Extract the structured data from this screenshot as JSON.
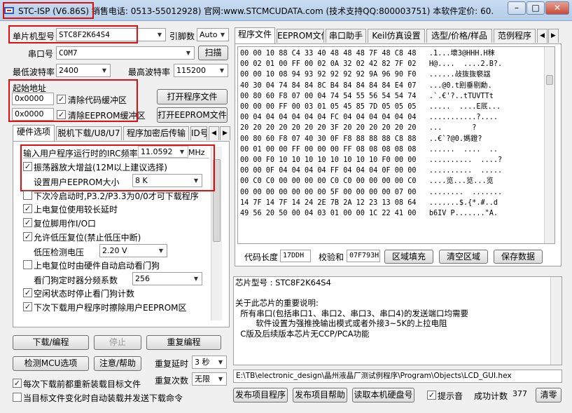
{
  "window": {
    "title": "STC-ISP (V6.86S) 销售电话: 0513-55012928) 官网:www.STCMCUDATA.com (技术支持QQ:800003751) 本软件定价: 60...",
    "minimize": "–",
    "maximize": "□",
    "close": "✕"
  },
  "left": {
    "chip_label": "单片机型号",
    "chip_value": "STC8F2K64S4",
    "pins_label": "引脚数",
    "pins_value": "Auto",
    "port_label": "串口号",
    "port_value": "COM7",
    "scan_button": "扫描",
    "min_baud_label": "最低波特率",
    "min_baud_value": "2400",
    "max_baud_label": "最高波特率",
    "max_baud_value": "115200",
    "start_addr_label": "起始地址",
    "code_addr": "0x0000",
    "clear_code_label": "清除代码缓冲区",
    "eeprom_addr": "0x0000",
    "clear_eeprom_label": "清除EEPROM缓冲区",
    "open_program_button": "打开程序文件",
    "open_eeprom_button": "打开EEPROM文件",
    "tabs": [
      "硬件选项",
      "脱机下载/U8/U7",
      "程序加密后传输",
      "ID号"
    ],
    "irc_label": "输入用户程序运行时的IRC频率",
    "irc_value": "11.0592",
    "irc_unit": "MHz",
    "options": [
      {
        "label": "振荡器放大增益(12M以上建议选择)",
        "checked": true
      },
      {
        "label": "设置用户EEPROM大小",
        "value": "8 K"
      },
      {
        "label": "下次冷启动时,P3.2/P3.3为0/0才可下载程序",
        "checked": false
      },
      {
        "label": "上电复位使用较长延时",
        "checked": true
      },
      {
        "label": "复位脚用作I/O口",
        "checked": true
      },
      {
        "label": "允许低压复位(禁止低压中断)",
        "checked": true
      },
      {
        "label": "低压检测电压",
        "value": "2.20 V"
      },
      {
        "label": "上电复位时由硬件自动启动看门狗",
        "checked": false
      },
      {
        "label": "看门狗定时器分频系数",
        "value": "256"
      },
      {
        "label": "空闲状态时停止看门狗计数",
        "checked": true
      },
      {
        "label": "下次下载用户程序时擦除用户EEPROM区",
        "checked": true
      }
    ],
    "download_button": "下载/编程",
    "stop_button": "停止",
    "reprogram_button": "重复编程",
    "detect_button": "检测MCU选项",
    "help_button": "注意/帮助",
    "repeat_delay_label": "重复延时",
    "repeat_delay_value": "3 秒",
    "repeat_count_label": "重复次数",
    "repeat_count_value": "无限",
    "reload_label": "每次下载前都重新装载目标文件",
    "auto_load_label": "当目标文件变化时自动装载并发送下载命令"
  },
  "right": {
    "tabs": [
      "程序文件",
      "EEPROM文件",
      "串口助手",
      "Keil仿真设置",
      "选型/价格/样品",
      "范例程序"
    ],
    "hex_rows": [
      {
        "hex": "00 00 10 88 C4 33 40 48 48 48 7F 48 C8 48",
        "ascii": ".1...壞3@HHH.H秣"
      },
      {
        "hex": "00 02 01 00 FF 00 02 0A 32 02 42 82 7F 02",
        "ascii": "H@....  ....2.B?."
      },
      {
        "hex": "00 00 10 08 94 93 92 92 92 92 9A 96 90 F0",
        "ascii": "......敁抜抜褻諡"
      },
      {
        "hex": "40 30 04 74 84 84 8C B4 84 84 84 84 E4 07",
        "ascii": "...@0.t刡垂剔勳."
      },
      {
        "hex": "00 80 60 F8 07 00 04 74 54 55 56 54 54 74",
        "ascii": ".`.€'?..tTUVTTt"
      },
      {
        "hex": "00 00 00 FF 00 03 01 05 45 85 7D 05 05 05",
        "ascii": ".....  ....E厎..."
      },
      {
        "hex": "00 04 04 04 04 04 04 FC 04 04 04 04 04 04",
        "ascii": "...........?...."
      },
      {
        "hex": "20 20 20 20 20 20 20 3F 20 20 20 20 20 20",
        "ascii": "...       ?"
      },
      {
        "hex": "00 80 60 F8 07 40 30 0F F8 88 88 88 C8 88",
        "ascii": "..€`?@0.媽鐙?"
      },
      {
        "hex": "00 01 00 00 FF 00 00 00 FF 08 08 08 08 08",
        "ascii": "......  ....  .."
      },
      {
        "hex": "00 00 F0 10 10 10 10 10 10 10 10 F0 00 00",
        "ascii": "..........  ....?"
      },
      {
        "hex": "00 00 0F 04 04 04 04 FF 04 04 04 0F 00 00",
        "ascii": "..........  ....."
      },
      {
        "hex": "00 C0 C0 00 00 00 00 C0 C0 00 00 00 00 C0",
        "ascii": "....览...览...览"
      },
      {
        "hex": "00 00 00 00 00 00 00 5F 00 00 00 00 07 00",
        "ascii": "........  ......."
      },
      {
        "hex": "14 7F 14 7F 14 24 2E 7B 2A 12 23 13 08 64",
        "ascii": ".......$.{*.#..d"
      },
      {
        "hex": "49 56 20 50 00 04 03 01 00 00 1C 22 41 00",
        "ascii": "b6IV P.......\"A."
      }
    ],
    "code_len_label": "代码长度",
    "code_len_value": "17DDH",
    "checksum_label": "校验和",
    "checksum_value": "07F793H",
    "fill_button": "区域填充",
    "clear_button": "清空区域",
    "save_button": "保存数据",
    "info_lines": [
      "芯片型号 : STC8F2K64S4",
      "",
      "关于此芯片的重要说明:",
      "  所有串口(包括串口1、串口2、串口3、串口4)的发送端口均需要",
      "        软件设置为强推挽输出模式或者外接3~5K的上拉电阻",
      "  C版及后续版本芯片无CCP/PCA功能"
    ],
    "file_path": "E:\\TB\\electronic_design\\晶州液晶厂测试例程序\\Program\\Objects\\LCD_GUI.hex",
    "publish_button": "发布项目程序",
    "publish_help_button": "发布项目帮助",
    "read_disk_button": "读取本机硬盘号",
    "sound_label": "提示音",
    "success_label": "成功计数",
    "success_value": "377",
    "clear_count_button": "清零"
  }
}
